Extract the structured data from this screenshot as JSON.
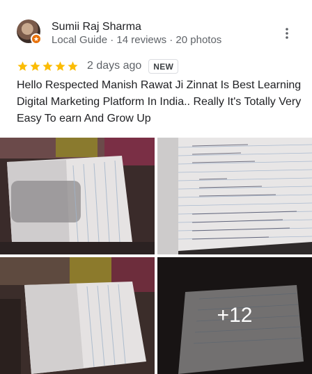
{
  "reviewer": {
    "name": "Sumii Raj Sharma",
    "meta": "Local Guide · 14 reviews · 20 photos"
  },
  "review": {
    "rating": 5,
    "date": "2 days ago",
    "badge": "NEW",
    "text": "Hello Respected Manish Rawat Ji Zinnat Is Best Learning Digital Marketing Platform In India.. Really It's Totally Very Easy To earn And Grow Up"
  },
  "photos": {
    "more_count": "+12"
  },
  "colors": {
    "star": "#fbbc04",
    "badge_orange": "#e8710a",
    "text_primary": "#202124",
    "text_secondary": "#5f6368"
  },
  "icons": {
    "avatar_badge": "local-guide-badge-icon",
    "menu": "more-vert-icon",
    "star": "star-icon"
  }
}
